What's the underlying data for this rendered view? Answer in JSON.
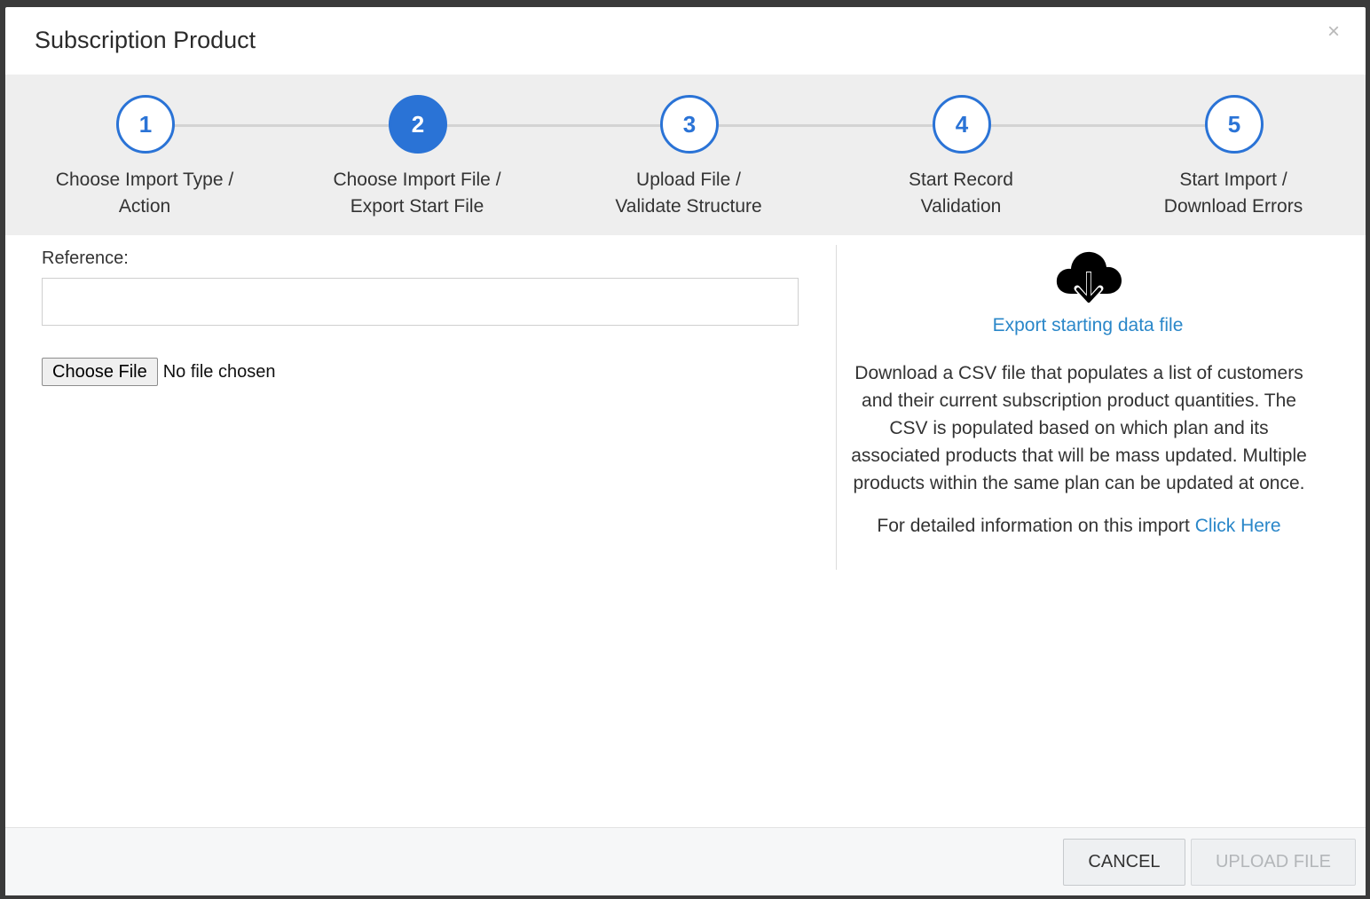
{
  "modal": {
    "title": "Subscription Product",
    "close_glyph": "×"
  },
  "stepper": {
    "active_step": 2,
    "steps": [
      {
        "number": "1",
        "line1": "Choose Import Type /",
        "line2": "Action"
      },
      {
        "number": "2",
        "line1": "Choose Import File /",
        "line2": "Export Start File"
      },
      {
        "number": "3",
        "line1": "Upload File /",
        "line2": "Validate Structure"
      },
      {
        "number": "4",
        "line1": "Start Record",
        "line2": "Validation"
      },
      {
        "number": "5",
        "line1": "Start Import /",
        "line2": "Download Errors"
      }
    ]
  },
  "form": {
    "reference_label": "Reference:",
    "reference_value": "",
    "choose_file_label": "Choose File",
    "no_file_text": "No file chosen"
  },
  "export": {
    "icon": "cloud-download-icon",
    "link_text": "Export starting data file",
    "description": "Download a CSV file that populates a list of customers and their current subscription product quantities. The CSV is populated based on which plan and its associated products that will be mass updated. Multiple products within the same plan can be updated at once.",
    "detail_prefix": "For detailed information on this import",
    "detail_link": "Click Here"
  },
  "footer": {
    "cancel_label": "CANCEL",
    "upload_label": "UPLOAD FILE"
  },
  "colors": {
    "accent": "#2a73d6",
    "link": "#2a87c9"
  }
}
